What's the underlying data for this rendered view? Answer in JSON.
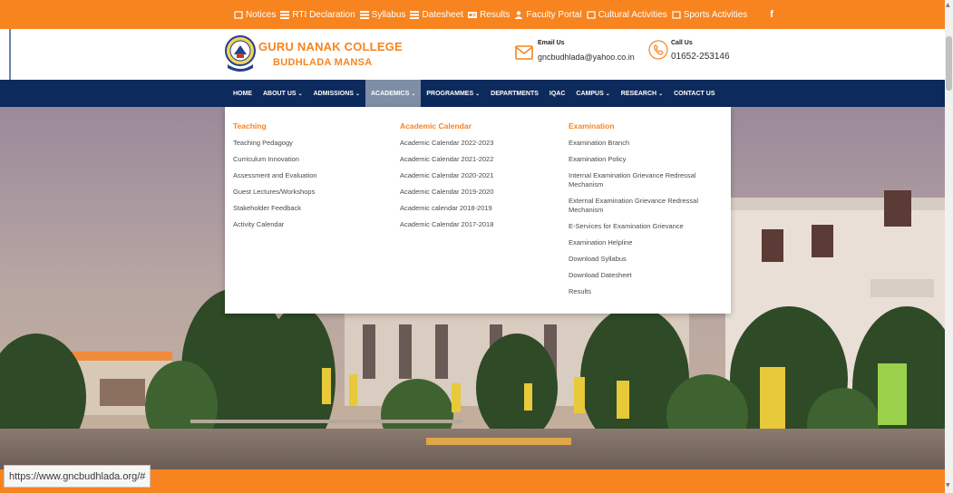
{
  "topbar": {
    "items": [
      {
        "label": "Notices",
        "icon": "square-icon"
      },
      {
        "label": "RTI Declaration",
        "icon": "list-icon"
      },
      {
        "label": "Syllabus",
        "icon": "list-icon"
      },
      {
        "label": "Datesheet",
        "icon": "list-icon"
      },
      {
        "label": "Results",
        "icon": "card-icon"
      },
      {
        "label": "Faculty Portal",
        "icon": "user-icon"
      },
      {
        "label": "Cultural Activities",
        "icon": "square-icon"
      },
      {
        "label": "Sports Activities",
        "icon": "square-icon"
      }
    ],
    "facebook": "f"
  },
  "header": {
    "college_name": "GURU NANAK COLLEGE",
    "college_place": "BUDHLADA MANSA",
    "email_title": "Email Us",
    "email_value": "gncbudhlada@yahoo.co.in",
    "call_title": "Call Us",
    "call_value": "01652-253146"
  },
  "nav": {
    "items": [
      {
        "label": "HOME",
        "caret": false
      },
      {
        "label": "ABOUT US",
        "caret": true
      },
      {
        "label": "ADMISSIONS",
        "caret": true
      },
      {
        "label": "ACADEMICS",
        "caret": true,
        "active": true
      },
      {
        "label": "PROGRAMMES",
        "caret": true
      },
      {
        "label": "DEPARTMENTS",
        "caret": false
      },
      {
        "label": "IQAC",
        "caret": false
      },
      {
        "label": "CAMPUS",
        "caret": true
      },
      {
        "label": "RESEARCH",
        "caret": true
      },
      {
        "label": "CONTACT US",
        "caret": false
      }
    ],
    "caret_glyph": "⌄"
  },
  "dropdown": {
    "teaching": {
      "heading": "Teaching",
      "links": [
        "Teaching Pedagogy",
        "Curriculum Innovation",
        "Assessment and Evaluation",
        "Guest Lectures/Workshops",
        "Stakeholder Feedback",
        "Activity Calendar"
      ]
    },
    "academic_calendar": {
      "heading": "Academic Calendar",
      "links": [
        "Academic Calendar 2022-2023",
        "Academic Calendar 2021-2022",
        "Academic Calendar 2020-2021",
        "Academic Calendar 2019-2020",
        "Academic calendar 2018-2019",
        "Academic Calendar 2017-2018"
      ]
    },
    "examination": {
      "heading": "Examination",
      "links": [
        "Examination Branch",
        "Examination Policy",
        "Internal Examination Grievance Redressal Mechanism",
        "External Examination Grievance Redressal Mechanism",
        "E-Services for Examination Grievance",
        "Examination Helpline",
        "Download Syllabus",
        "Download Datesheet",
        "Results"
      ]
    }
  },
  "status": {
    "url": "https://www.gncbudhlada.org/#"
  },
  "colors": {
    "accent": "#f7841e",
    "navy": "#0d2a5c",
    "active_nav": "#7e8ea6"
  }
}
